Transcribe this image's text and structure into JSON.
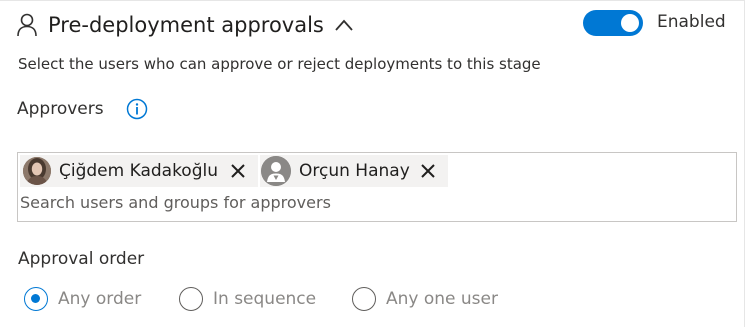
{
  "section": {
    "title": "Pre-deployment approvals",
    "icons": {
      "header": "person-icon",
      "collapse": "chevron-up-icon"
    },
    "toggle": {
      "label": "Enabled",
      "on": true
    },
    "description": "Select the users who can approve or reject deployments to this stage"
  },
  "approvers": {
    "label": "Approvers",
    "info_icon": "info-icon",
    "selected": [
      {
        "name": "Çiğdem Kadakoğlu",
        "avatar": "photo-avatar",
        "remove_icon": "close-icon"
      },
      {
        "name": "Orçun Hanay",
        "avatar": "default-user-avatar",
        "remove_icon": "close-icon"
      }
    ],
    "search_placeholder": "Search users and groups for approvers"
  },
  "approval_order": {
    "label": "Approval order",
    "options": [
      {
        "label": "Any order",
        "selected": true
      },
      {
        "label": "In sequence",
        "selected": false
      },
      {
        "label": "Any one user",
        "selected": false
      }
    ]
  },
  "colors": {
    "accent": "#0078d4",
    "text": "#323130",
    "muted": "#8a8886",
    "pill_bg": "#f3f2f1"
  }
}
